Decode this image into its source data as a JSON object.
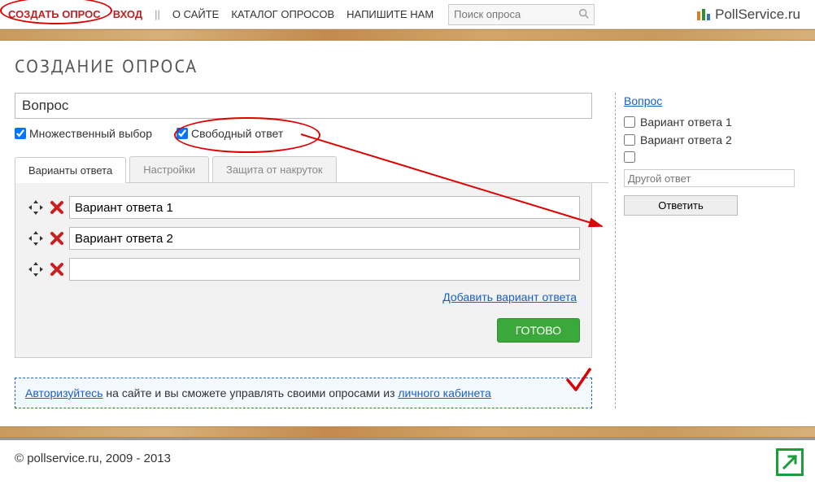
{
  "nav": {
    "create": "СОЗДАТЬ ОПРОС",
    "login": "ВХОД",
    "about": "О САЙТЕ",
    "catalog": "КАТАЛОГ ОПРОСОВ",
    "write": "НАПИШИТЕ НАМ"
  },
  "search": {
    "placeholder": "Поиск опроса"
  },
  "brand": "PollService.ru",
  "page_title": "СОЗДАНИЕ ОПРОСА",
  "editor": {
    "question_value": "Вопрос",
    "multiple_label": "Множественный выбор",
    "free_label": "Свободный ответ",
    "tabs": {
      "variants": "Варианты ответа",
      "settings": "Настройки",
      "antifraud": "Защита от накруток"
    },
    "options": [
      "Вариант ответа 1",
      "Вариант ответа 2",
      ""
    ],
    "add_option": "Добавить вариант ответа",
    "ready": "ГОТОВО"
  },
  "authbox": {
    "link1": "Авторизуйтесь",
    "mid": " на сайте и вы сможете управлять своими опросами из ",
    "link2": "личного кабинета"
  },
  "preview": {
    "question": "Вопрос",
    "options": [
      "Вариант ответа 1",
      "Вариант ответа 2"
    ],
    "other_placeholder": "Другой ответ",
    "submit": "Ответить"
  },
  "footer": "© pollservice.ru, 2009 - 2013"
}
